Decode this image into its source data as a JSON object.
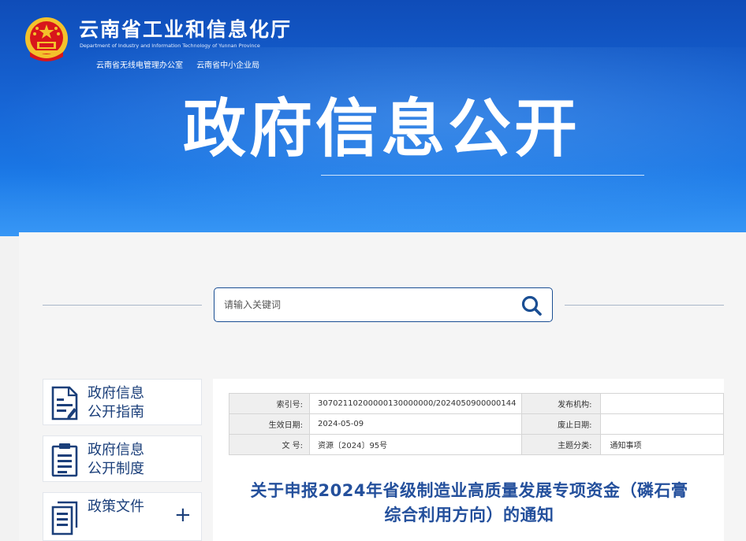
{
  "header": {
    "site_name": "云南省工业和信息化厅",
    "site_name_en": "Department of Industry and Information Technology of Yunnan Province",
    "sub_orgs": [
      "云南省无线电管理办公室",
      "云南省中小企业局"
    ],
    "banner_title": "政府信息公开",
    "emblem_icon": "national-emblem-icon"
  },
  "search": {
    "placeholder": "请输入关键词",
    "value": "",
    "button_icon": "search-icon"
  },
  "sidebar": {
    "items": [
      {
        "line1": "政府信息",
        "line2": "公开指南",
        "icon": "guide-document-icon"
      },
      {
        "line1": "政府信息",
        "line2": "公开制度",
        "icon": "clipboard-list-icon"
      },
      {
        "line1": "政策文件",
        "line2": "",
        "icon": "documents-stack-icon",
        "expand": "+"
      }
    ]
  },
  "meta": {
    "index_label": "索引号:",
    "index_value": "30702110200000130000000/2024050900000144",
    "publisher_label": "发布机构:",
    "publisher_value": "",
    "effective_label": "生效日期:",
    "effective_value": "2024-05-09",
    "expire_label": "废止日期:",
    "expire_value": "",
    "docno_label": "文 号:",
    "docno_value": "资源〔2024〕95号",
    "topic_label": "主题分类:",
    "topic_value": "通知事项"
  },
  "document": {
    "title_line1": "关于申报2024年省级制造业高质量发展专项资金（磷石膏",
    "title_line2": "综合利用方向）的通知"
  },
  "colors": {
    "banner_blue": "#1766d6",
    "nav_text": "#1b3f7a",
    "title_blue": "#24509c",
    "emblem_red": "#d8161b",
    "emblem_gold": "#f3c22b"
  }
}
